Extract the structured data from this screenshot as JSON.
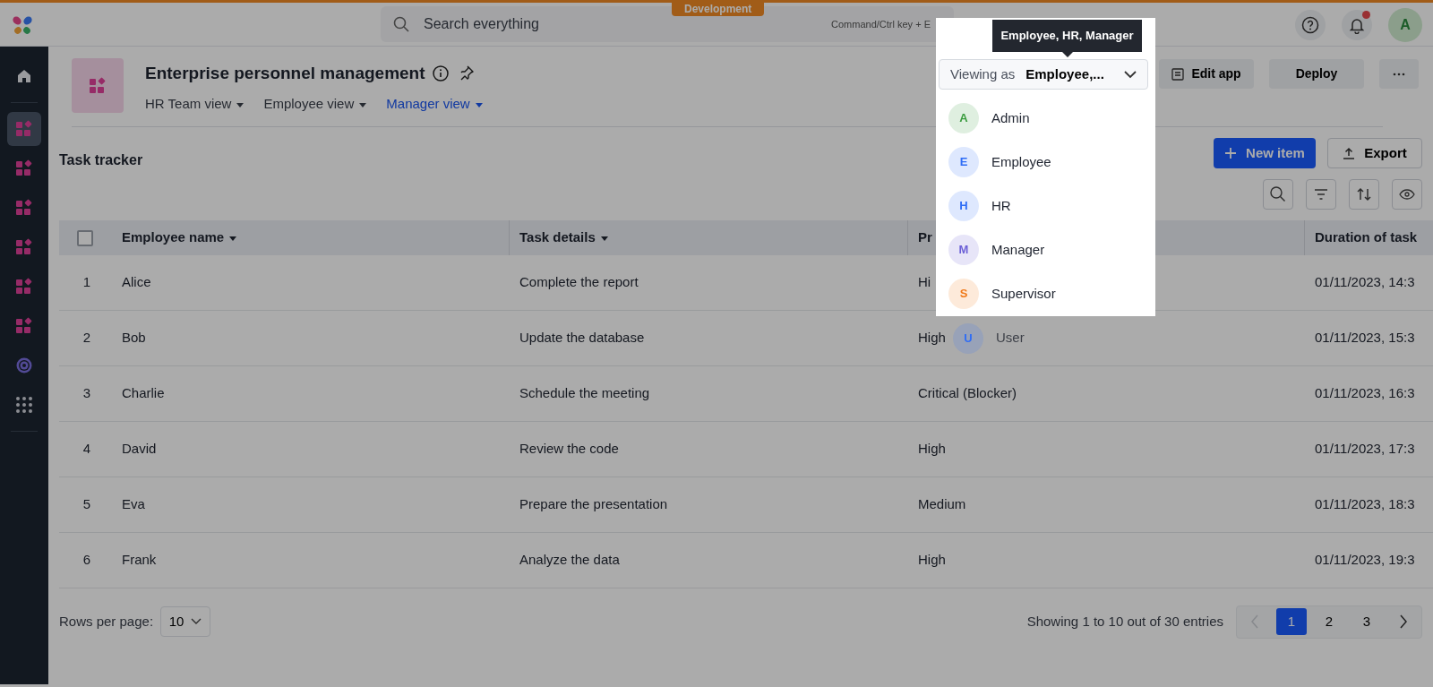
{
  "top_bar": {
    "environment_badge": "Development",
    "search": {
      "placeholder": "Search everything",
      "shortcut": "Command/Ctrl key + E"
    },
    "notification_unread": true,
    "user_avatar": "A"
  },
  "sidebar": {
    "items": [
      {
        "kind": "home",
        "selected": false
      },
      {
        "kind": "app",
        "selected": true
      },
      {
        "kind": "app",
        "selected": false
      },
      {
        "kind": "app",
        "selected": false
      },
      {
        "kind": "app",
        "selected": false
      },
      {
        "kind": "app",
        "selected": false
      },
      {
        "kind": "app",
        "selected": false
      },
      {
        "kind": "target",
        "selected": false
      },
      {
        "kind": "apps_grid",
        "selected": false
      }
    ]
  },
  "app": {
    "title": "Enterprise personnel management",
    "views": [
      {
        "label": "HR Team view",
        "selected": false
      },
      {
        "label": "Employee view",
        "selected": false
      },
      {
        "label": "Manager view",
        "selected": true
      }
    ],
    "actions": [
      {
        "kind": "edit",
        "label": "Edit app"
      },
      {
        "kind": "plain",
        "label": "Deploy"
      },
      {
        "kind": "more"
      }
    ]
  },
  "viewing_as": {
    "label": "Viewing as",
    "value": "Employee,...",
    "tooltip": "Employee, HR, Manager",
    "options": [
      {
        "initial": "A",
        "label": "Admin",
        "color": "#3a9c3f",
        "covered": false
      },
      {
        "initial": "E",
        "label": "Employee",
        "color": "#2f6df6",
        "covered": false
      },
      {
        "initial": "H",
        "label": "HR",
        "color": "#2f6df6",
        "covered": false
      },
      {
        "initial": "M",
        "label": "Manager",
        "color": "#6b5fd6",
        "covered": false
      },
      {
        "initial": "S",
        "label": "Supervisor",
        "color": "#f07a1a",
        "covered": false
      },
      {
        "initial": "U",
        "label": "User",
        "color": "#2f6df6",
        "covered": true
      }
    ]
  },
  "table": {
    "title": "Task tracker",
    "new_button": "New item",
    "export_button": "Export",
    "select_all_checked": false,
    "columns": [
      {
        "label": "Employee name",
        "sortable": true
      },
      {
        "label": "Task details",
        "sortable": true
      },
      {
        "label": "Pr",
        "sortable": false
      },
      {
        "label": "Duration of task",
        "sortable": false
      }
    ],
    "rows": [
      {
        "number": "1",
        "cells": [
          "Alice",
          "Complete the report",
          "Hi",
          "01/11/2023, 14:3"
        ]
      },
      {
        "number": "2",
        "cells": [
          "Bob",
          "Update the database",
          "High",
          "01/11/2023, 15:3"
        ]
      },
      {
        "number": "3",
        "cells": [
          "Charlie",
          "Schedule the meeting",
          "Critical (Blocker)",
          "01/11/2023, 16:3"
        ]
      },
      {
        "number": "4",
        "cells": [
          "David",
          "Review the code",
          "High",
          "01/11/2023, 17:3"
        ]
      },
      {
        "number": "5",
        "cells": [
          "Eva",
          "Prepare the presentation",
          "Medium",
          "01/11/2023, 18:3"
        ]
      },
      {
        "number": "6",
        "cells": [
          "Frank",
          "Analyze the data",
          "High",
          "01/11/2023, 19:3"
        ]
      }
    ]
  },
  "pagination": {
    "rows_per_page_label": "Rows per page:",
    "rows_per_page": "10",
    "summary": "Showing 1 to 10 out of 30 entries",
    "previous_disabled": true,
    "next_disabled": false,
    "pages": [
      {
        "label": "1",
        "selected": true
      },
      {
        "label": "2",
        "selected": false
      },
      {
        "label": "3",
        "selected": false
      }
    ]
  }
}
